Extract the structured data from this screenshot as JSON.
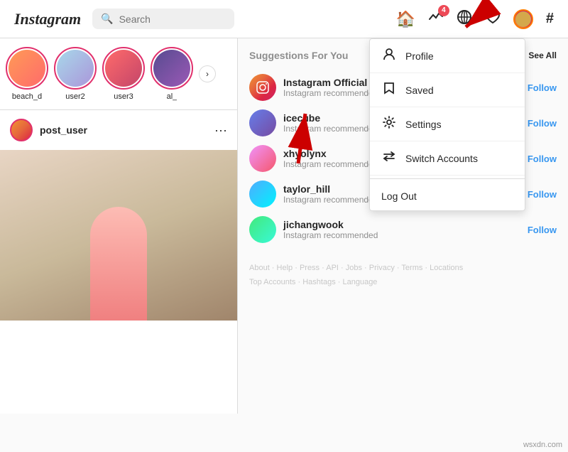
{
  "header": {
    "logo": "Instagram",
    "search_placeholder": "Search",
    "nav_icons": {
      "home": "🏠",
      "activity": "📈",
      "explore": "⊙",
      "heart": "♡",
      "hashtag": "#"
    },
    "notification_badge": "4"
  },
  "dropdown": {
    "items": [
      {
        "id": "profile",
        "label": "Profile",
        "icon": "person"
      },
      {
        "id": "saved",
        "label": "Saved",
        "icon": "bookmark"
      },
      {
        "id": "settings",
        "label": "Settings",
        "icon": "gear"
      },
      {
        "id": "switch",
        "label": "Switch Accounts",
        "icon": "switch"
      }
    ],
    "logout": "Log Out"
  },
  "stories": [
    {
      "id": 1,
      "label": "beach_d"
    },
    {
      "id": 2,
      "label": "user2"
    },
    {
      "id": 3,
      "label": "user3"
    },
    {
      "id": 4,
      "label": "al_"
    }
  ],
  "post": {
    "username": "post_user",
    "more_icon": "···"
  },
  "suggestions": {
    "title": "Suggestions For You",
    "see_all": "See All",
    "items": [
      {
        "id": "instagram",
        "username": "Instagram Official Account",
        "sub": "Instagram recommended",
        "follow": "Follow"
      },
      {
        "id": "icecube",
        "username": "icecube",
        "sub": "Instagram recommended",
        "follow": "Follow"
      },
      {
        "id": "xhyolynx",
        "username": "xhyolynx",
        "sub": "Instagram recommended",
        "follow": "Follow"
      },
      {
        "id": "taylor_hill",
        "username": "taylor_hill",
        "sub": "Instagram recommended",
        "follow": "Follow"
      },
      {
        "id": "jichangwook",
        "username": "jichangwook",
        "sub": "Instagram recommended",
        "follow": "Follow"
      }
    ]
  },
  "footer": {
    "links": [
      "About",
      "Help",
      "Press",
      "API",
      "Jobs",
      "Privacy",
      "Terms",
      "Locations"
    ],
    "links2": [
      "Top Accounts",
      "Hashtags",
      "Language"
    ]
  },
  "watermark": "wsxdn.com"
}
